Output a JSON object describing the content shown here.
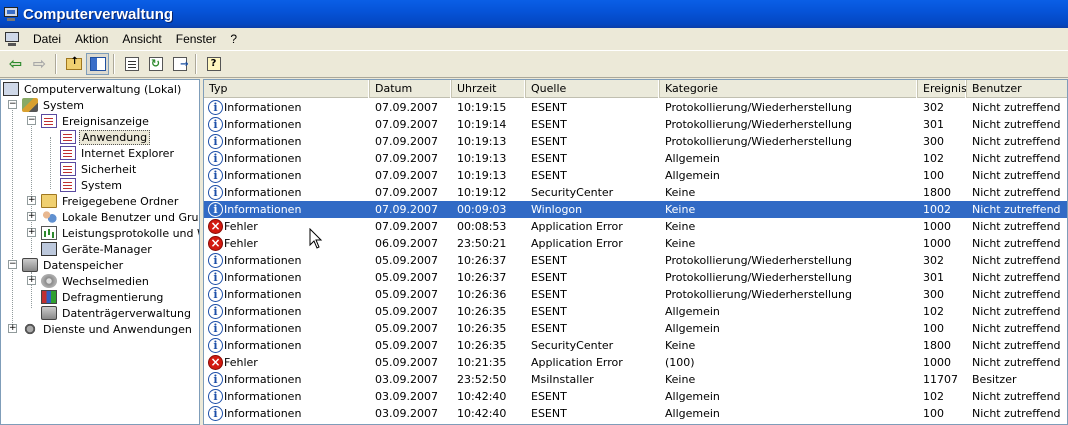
{
  "window": {
    "title": "Computerverwaltung"
  },
  "menu": [
    "Datei",
    "Aktion",
    "Ansicht",
    "Fenster",
    "?"
  ],
  "toolbar": [
    "back-arrow-icon",
    "forward-arrow-icon",
    "folder-up-icon",
    "show-tree-icon",
    "properties-icon",
    "refresh-icon",
    "export-list-icon",
    "help-icon"
  ],
  "tree": {
    "root": "Computerverwaltung (Lokal)",
    "system": "System",
    "eventviewer": "Ereignisanzeige",
    "logs": [
      "Anwendung",
      "Internet Explorer",
      "Sicherheit",
      "System"
    ],
    "shared": "Freigegebene Ordner",
    "users": "Lokale Benutzer und Gruppen",
    "perf": "Leistungsprotokolle und Warnungen",
    "devices": "Geräte-Manager",
    "storage": "Datenspeicher",
    "removable": "Wechselmedien",
    "defrag": "Defragmentierung",
    "diskmgmt": "Datenträgerverwaltung",
    "services": "Dienste und Anwendungen",
    "selected": "Anwendung"
  },
  "columns": [
    "Typ",
    "Datum",
    "Uhrzeit",
    "Quelle",
    "Kategorie",
    "Ereignis",
    "Benutzer"
  ],
  "events": [
    {
      "type": "Informationen",
      "kind": "info",
      "date": "07.09.2007",
      "time": "10:19:15",
      "source": "ESENT",
      "category": "Protokollierung/Wiederherstellung",
      "event": "302",
      "user": "Nicht zutreffend"
    },
    {
      "type": "Informationen",
      "kind": "info",
      "date": "07.09.2007",
      "time": "10:19:14",
      "source": "ESENT",
      "category": "Protokollierung/Wiederherstellung",
      "event": "301",
      "user": "Nicht zutreffend"
    },
    {
      "type": "Informationen",
      "kind": "info",
      "date": "07.09.2007",
      "time": "10:19:13",
      "source": "ESENT",
      "category": "Protokollierung/Wiederherstellung",
      "event": "300",
      "user": "Nicht zutreffend"
    },
    {
      "type": "Informationen",
      "kind": "info",
      "date": "07.09.2007",
      "time": "10:19:13",
      "source": "ESENT",
      "category": "Allgemein",
      "event": "102",
      "user": "Nicht zutreffend"
    },
    {
      "type": "Informationen",
      "kind": "info",
      "date": "07.09.2007",
      "time": "10:19:13",
      "source": "ESENT",
      "category": "Allgemein",
      "event": "100",
      "user": "Nicht zutreffend"
    },
    {
      "type": "Informationen",
      "kind": "info",
      "date": "07.09.2007",
      "time": "10:19:12",
      "source": "SecurityCenter",
      "category": "Keine",
      "event": "1800",
      "user": "Nicht zutreffend"
    },
    {
      "type": "Informationen",
      "kind": "info",
      "date": "07.09.2007",
      "time": "00:09:03",
      "source": "Winlogon",
      "category": "Keine",
      "event": "1002",
      "user": "Nicht zutreffend",
      "selected": true
    },
    {
      "type": "Fehler",
      "kind": "error",
      "date": "07.09.2007",
      "time": "00:08:53",
      "source": "Application Error",
      "category": "Keine",
      "event": "1000",
      "user": "Nicht zutreffend"
    },
    {
      "type": "Fehler",
      "kind": "error",
      "date": "06.09.2007",
      "time": "23:50:21",
      "source": "Application Error",
      "category": "Keine",
      "event": "1000",
      "user": "Nicht zutreffend"
    },
    {
      "type": "Informationen",
      "kind": "info",
      "date": "05.09.2007",
      "time": "10:26:37",
      "source": "ESENT",
      "category": "Protokollierung/Wiederherstellung",
      "event": "302",
      "user": "Nicht zutreffend"
    },
    {
      "type": "Informationen",
      "kind": "info",
      "date": "05.09.2007",
      "time": "10:26:37",
      "source": "ESENT",
      "category": "Protokollierung/Wiederherstellung",
      "event": "301",
      "user": "Nicht zutreffend"
    },
    {
      "type": "Informationen",
      "kind": "info",
      "date": "05.09.2007",
      "time": "10:26:36",
      "source": "ESENT",
      "category": "Protokollierung/Wiederherstellung",
      "event": "300",
      "user": "Nicht zutreffend"
    },
    {
      "type": "Informationen",
      "kind": "info",
      "date": "05.09.2007",
      "time": "10:26:35",
      "source": "ESENT",
      "category": "Allgemein",
      "event": "102",
      "user": "Nicht zutreffend"
    },
    {
      "type": "Informationen",
      "kind": "info",
      "date": "05.09.2007",
      "time": "10:26:35",
      "source": "ESENT",
      "category": "Allgemein",
      "event": "100",
      "user": "Nicht zutreffend"
    },
    {
      "type": "Informationen",
      "kind": "info",
      "date": "05.09.2007",
      "time": "10:26:35",
      "source": "SecurityCenter",
      "category": "Keine",
      "event": "1800",
      "user": "Nicht zutreffend"
    },
    {
      "type": "Fehler",
      "kind": "error",
      "date": "05.09.2007",
      "time": "10:21:35",
      "source": "Application Error",
      "category": "(100)",
      "event": "1000",
      "user": "Nicht zutreffend"
    },
    {
      "type": "Informationen",
      "kind": "info",
      "date": "03.09.2007",
      "time": "23:52:50",
      "source": "MsiInstaller",
      "category": "Keine",
      "event": "11707",
      "user": "Besitzer"
    },
    {
      "type": "Informationen",
      "kind": "info",
      "date": "03.09.2007",
      "time": "10:42:40",
      "source": "ESENT",
      "category": "Allgemein",
      "event": "102",
      "user": "Nicht zutreffend"
    },
    {
      "type": "Informationen",
      "kind": "info",
      "date": "03.09.2007",
      "time": "10:42:40",
      "source": "ESENT",
      "category": "Allgemein",
      "event": "100",
      "user": "Nicht zutreffend"
    }
  ],
  "colors": {
    "titlebar": "#0653d8",
    "selection": "#316ac5",
    "error": "#d21a10",
    "info": "#1d4fa8"
  }
}
